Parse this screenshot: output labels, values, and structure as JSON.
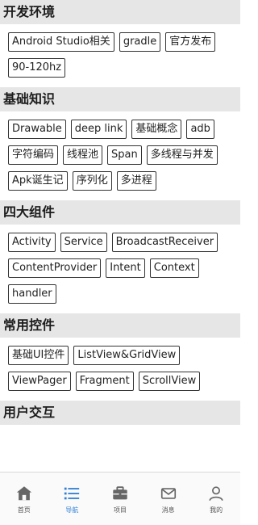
{
  "sections": [
    {
      "title": "开发环境",
      "tags": [
        "Android Studio相关",
        "gradle",
        "官方发布",
        "90-120hz"
      ]
    },
    {
      "title": "基础知识",
      "tags": [
        "Drawable",
        "deep link",
        "基础概念",
        "adb",
        "字符编码",
        "线程池",
        "Span",
        "多线程与并发",
        "Apk诞生记",
        "序列化",
        "多进程"
      ]
    },
    {
      "title": "四大组件",
      "tags": [
        "Activity",
        "Service",
        "BroadcastReceiver",
        "ContentProvider",
        "Intent",
        "Context",
        "handler"
      ]
    },
    {
      "title": "常用控件",
      "tags": [
        "基础UI控件",
        "ListView&GridView",
        "ViewPager",
        "Fragment",
        "ScrollView"
      ]
    },
    {
      "title": "用户交互",
      "tags": []
    }
  ],
  "nav": {
    "items": [
      {
        "label": "首页",
        "icon": "home-icon"
      },
      {
        "label": "导航",
        "icon": "list-icon"
      },
      {
        "label": "项目",
        "icon": "briefcase-icon"
      },
      {
        "label": "消息",
        "icon": "mail-icon"
      },
      {
        "label": "我的",
        "icon": "person-icon"
      }
    ],
    "active_index": 1,
    "active_color": "#2f7fd6",
    "icon_color": "#666666"
  }
}
